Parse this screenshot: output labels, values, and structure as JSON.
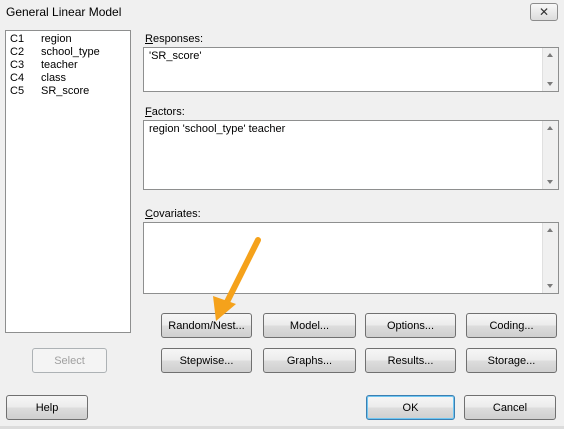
{
  "window": {
    "title": "General Linear Model",
    "close_label": "✕"
  },
  "variables": [
    {
      "id": "C1",
      "name": "region"
    },
    {
      "id": "C2",
      "name": "school_type"
    },
    {
      "id": "C3",
      "name": "teacher"
    },
    {
      "id": "C4",
      "name": "class"
    },
    {
      "id": "C5",
      "name": "SR_score"
    }
  ],
  "fields": {
    "responses": {
      "label_mnemonic": "R",
      "label_rest": "esponses:",
      "value": "'SR_score'"
    },
    "factors": {
      "label_mnemonic": "F",
      "label_rest": "actors:",
      "value": "region 'school_type' teacher"
    },
    "covariates": {
      "label_mnemonic": "C",
      "label_rest": "ovariates:",
      "value": ""
    }
  },
  "buttons": {
    "select": "Select",
    "random_nest": "Random/Nest...",
    "model": "Model...",
    "options": "Options...",
    "coding": "Coding...",
    "stepwise": "Stepwise...",
    "graphs": "Graphs...",
    "results": "Results...",
    "storage": "Storage...",
    "help": "Help",
    "ok": "OK",
    "cancel": "Cancel"
  },
  "annotation": {
    "arrow_color": "#f5a21b",
    "points_to": "random-nest-button"
  }
}
